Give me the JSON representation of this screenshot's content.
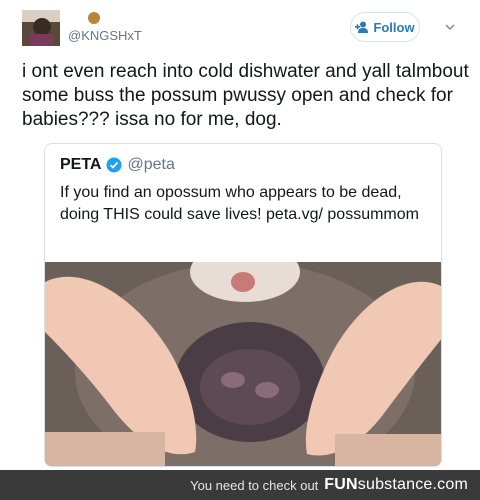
{
  "tweet": {
    "handle": "@KNGSHxT",
    "follow_label": "Follow",
    "text": "i ont even reach into cold dishwater and yall talmbout some buss the possum pwussy open and check for babies??? issa no for me, dog."
  },
  "quoted_tweet": {
    "name": "PETA",
    "handle": "@peta",
    "text": "If you find an opossum who appears to be dead, doing THIS could save lives! peta.vg/ possummom"
  },
  "footer": {
    "prompt": "You need to check out",
    "brand_part1": "FUN",
    "brand_part2": "substance.com"
  },
  "colors": {
    "link": "#2b7bb9",
    "verified": "#1da1f2",
    "footer_bg": "#3a3a3a"
  },
  "icons": [
    "avatar",
    "badge-icon",
    "follow-icon",
    "chevron-down-icon",
    "verified-icon"
  ]
}
